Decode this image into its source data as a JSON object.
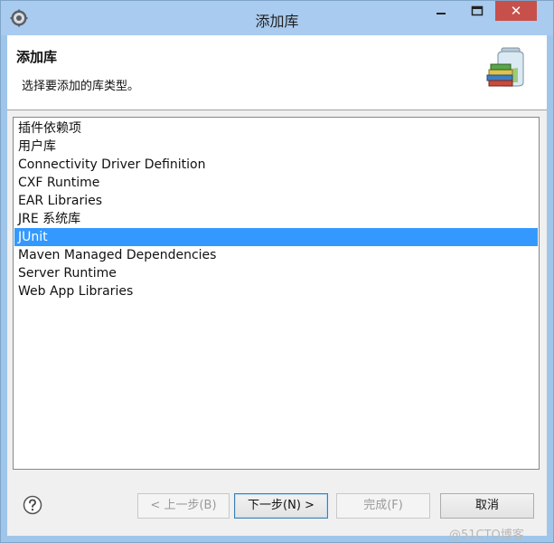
{
  "window": {
    "title": "添加库",
    "close_glyph": "✕"
  },
  "header": {
    "title": "添加库",
    "description": "选择要添加的库类型。"
  },
  "library_types": [
    {
      "label": "插件依赖项",
      "selected": false
    },
    {
      "label": "用户库",
      "selected": false
    },
    {
      "label": "Connectivity Driver Definition",
      "selected": false
    },
    {
      "label": "CXF Runtime",
      "selected": false
    },
    {
      "label": "EAR Libraries",
      "selected": false
    },
    {
      "label": "JRE 系统库",
      "selected": false
    },
    {
      "label": "JUnit",
      "selected": true
    },
    {
      "label": "Maven Managed Dependencies",
      "selected": false
    },
    {
      "label": "Server Runtime",
      "selected": false
    },
    {
      "label": "Web App Libraries",
      "selected": false
    }
  ],
  "buttons": {
    "back": "< 上一步(B)",
    "next": "下一步(N) >",
    "finish": "完成(F)",
    "cancel": "取消"
  },
  "icons": {
    "app": "gear-icon",
    "help": "help-icon",
    "library": "library-books-jar-icon"
  },
  "colors": {
    "selection": "#3399ff",
    "titlebar": "#a8cbef",
    "close_button": "#c7504a"
  },
  "watermark": "@51CTO博客"
}
